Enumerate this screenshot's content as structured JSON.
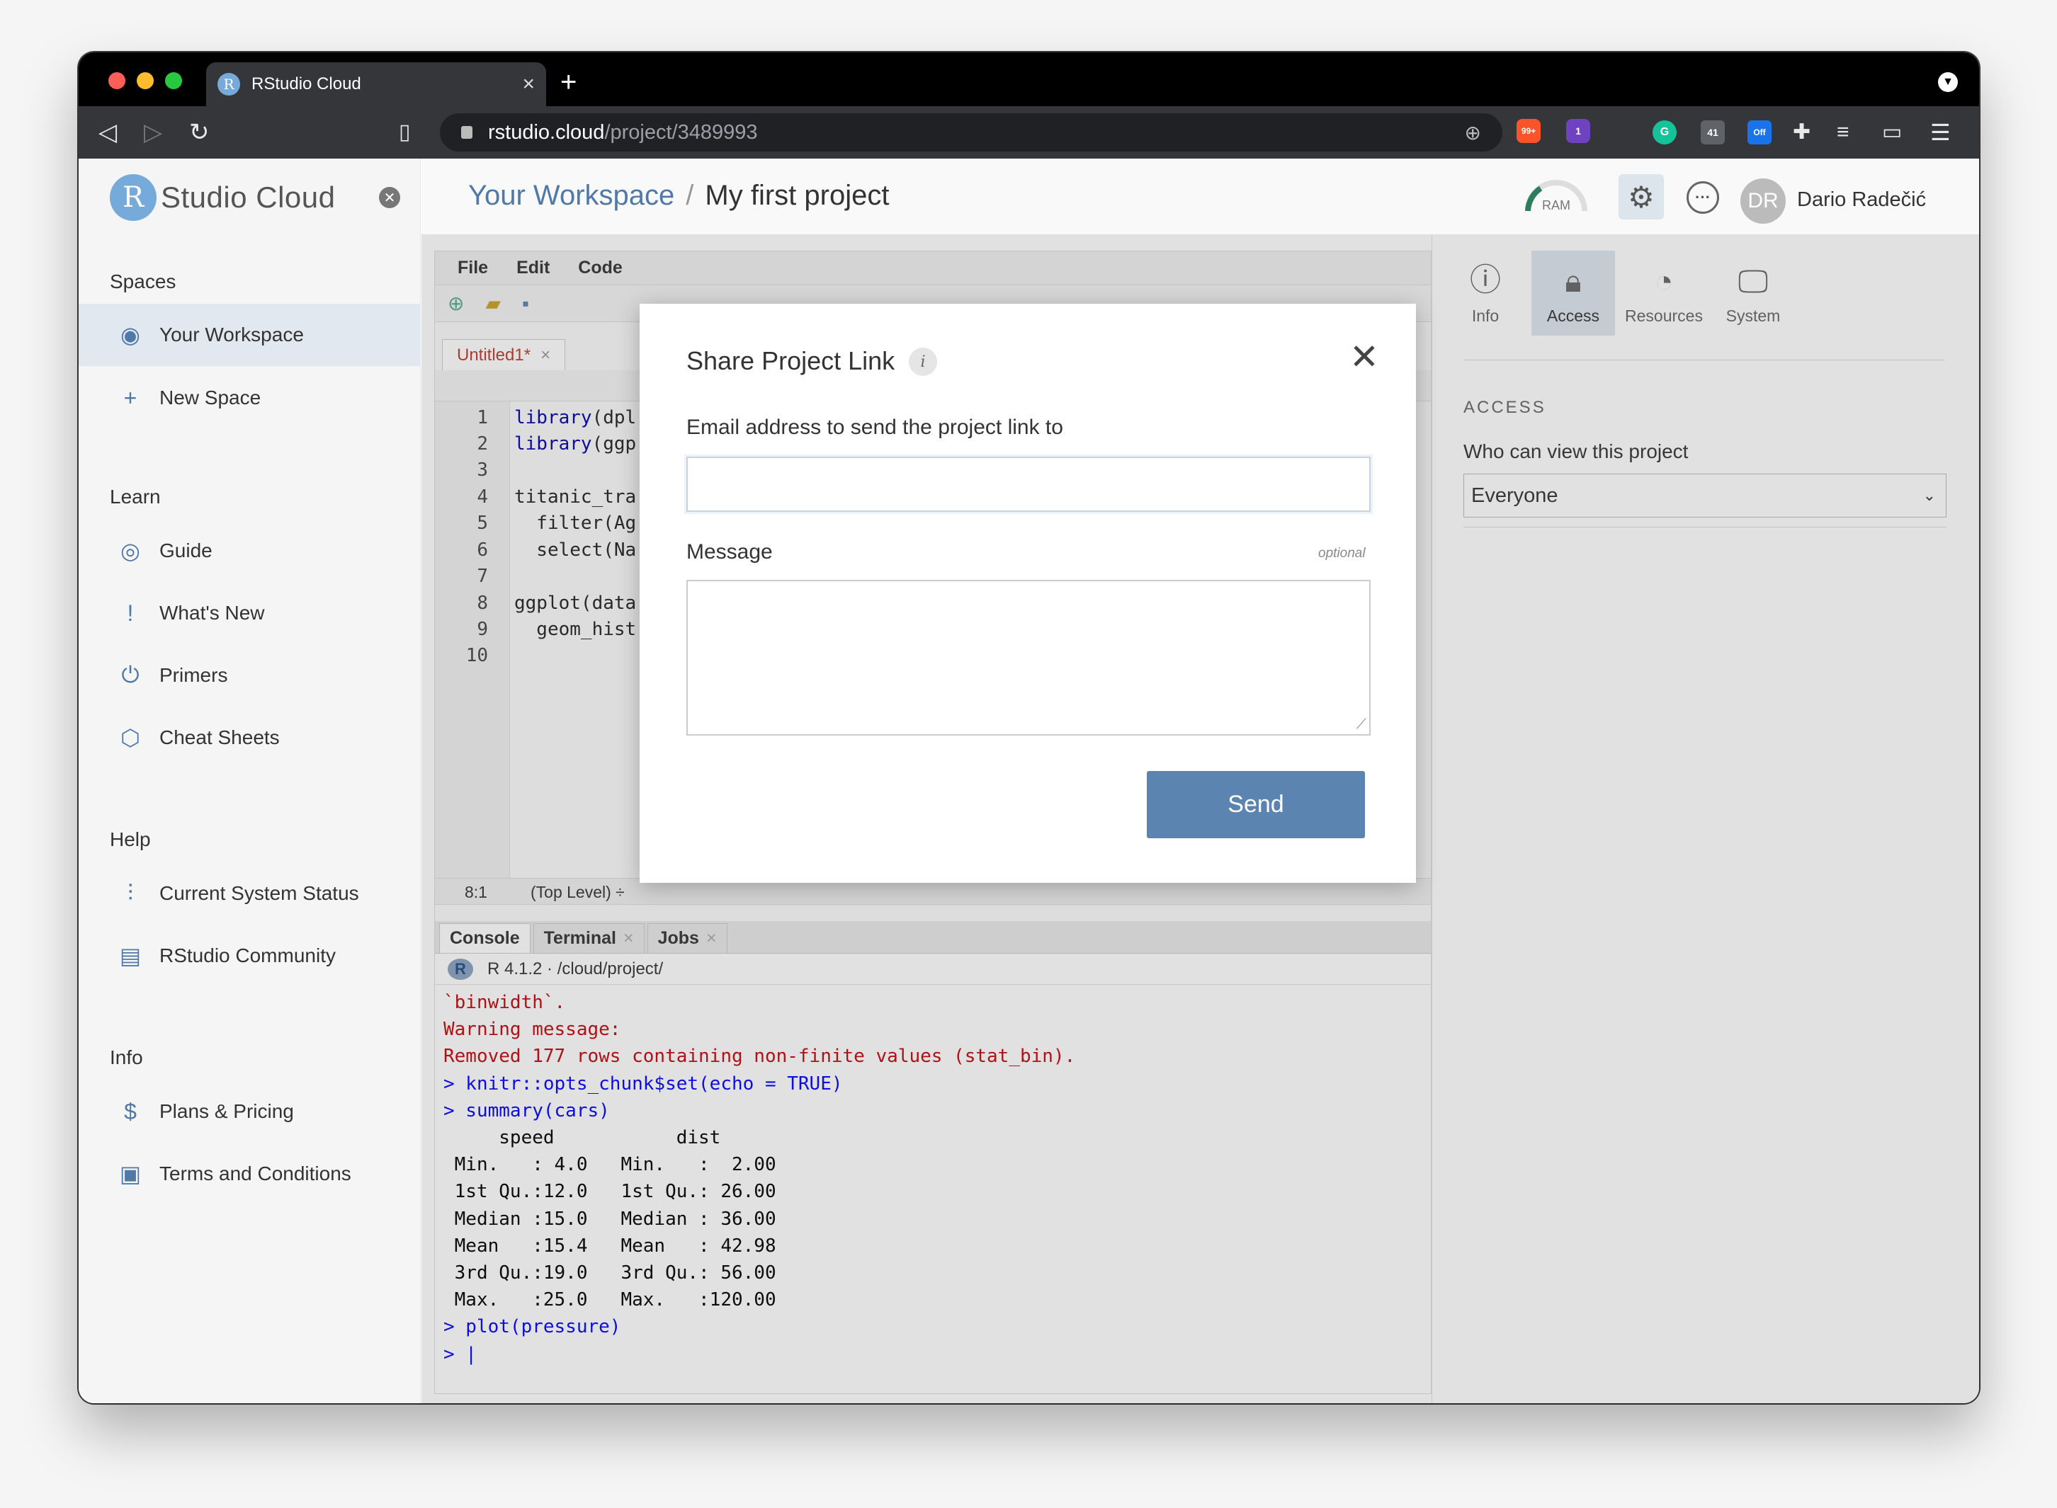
{
  "browser": {
    "tab_title": "RStudio Cloud",
    "tab_favicon": "R",
    "tab_close": "×",
    "new_tab": "+",
    "url_domain": "rstudio.cloud",
    "url_path": "/project/3489993",
    "brave_badge": "99+",
    "alert_badge": "1",
    "ext_calendar": "41",
    "ext_off": "Off",
    "colors": {
      "traffic_red": "#ff5f57",
      "traffic_yellow": "#febc2e",
      "traffic_green": "#28c840"
    }
  },
  "sidebar": {
    "logo_letter": "R",
    "logo_text": "Studio Cloud",
    "sections": {
      "spaces": "Spaces",
      "learn": "Learn",
      "help": "Help",
      "info": "Info"
    },
    "items": {
      "your_workspace": "Your Workspace",
      "new_space": "New Space",
      "guide": "Guide",
      "whats_new": "What's New",
      "primers": "Primers",
      "cheat_sheets": "Cheat Sheets",
      "system_status": "Current System Status",
      "community": "RStudio Community",
      "plans": "Plans & Pricing",
      "terms": "Terms and Conditions"
    }
  },
  "header": {
    "workspace": "Your Workspace",
    "separator": "/",
    "project": "My first project",
    "ram": "RAM",
    "avatar_initials": "DR",
    "user_name": "Dario Radečić"
  },
  "ide": {
    "menu": [
      "File",
      "Edit",
      "Code"
    ],
    "doc_tab": "Untitled1*",
    "doc_tab_close": "×",
    "line_numbers": [
      "1",
      "2",
      "3",
      "4",
      "5",
      "6",
      "7",
      "8",
      "9",
      "10"
    ],
    "code_lines": [
      {
        "fn": "library",
        "rest": "(dpl"
      },
      {
        "fn": "library",
        "rest": "(ggp"
      },
      {
        "fn": "",
        "rest": ""
      },
      {
        "fn": "",
        "rest": "titanic_tra"
      },
      {
        "fn": "  filter",
        "rest": "(Ag"
      },
      {
        "fn": "  select",
        "rest": "(Na"
      },
      {
        "fn": "",
        "rest": ""
      },
      {
        "fn": "ggplot",
        "rest": "(data"
      },
      {
        "fn": "",
        "rest": "  geom_hist"
      },
      {
        "fn": "",
        "rest": ""
      }
    ],
    "cursor_pos": "8:1",
    "scope": "(Top Level) ÷",
    "console_tabs": {
      "console": "Console",
      "terminal": "Terminal",
      "jobs": "Jobs",
      "close": "×"
    },
    "r_version": "R 4.1.2 · /cloud/project/",
    "console_lines": [
      {
        "t": "err",
        "text": "`binwidth`."
      },
      {
        "t": "err",
        "text": "Warning message:"
      },
      {
        "t": "err",
        "text": "Removed 177 rows containing non-finite values (stat_bin)."
      },
      {
        "t": "cmd",
        "text": "> knitr::opts_chunk$set(echo = TRUE)"
      },
      {
        "t": "cmd",
        "text": "> summary(cars)"
      },
      {
        "t": "out",
        "text": "     speed           dist       "
      },
      {
        "t": "out",
        "text": " Min.   : 4.0   Min.   :  2.00  "
      },
      {
        "t": "out",
        "text": " 1st Qu.:12.0   1st Qu.: 26.00  "
      },
      {
        "t": "out",
        "text": " Median :15.0   Median : 36.00  "
      },
      {
        "t": "out",
        "text": " Mean   :15.4   Mean   : 42.98  "
      },
      {
        "t": "out",
        "text": " 3rd Qu.:19.0   3rd Qu.: 56.00  "
      },
      {
        "t": "out",
        "text": " Max.   :25.0   Max.   :120.00  "
      },
      {
        "t": "cmd",
        "text": "> plot(pressure)"
      },
      {
        "t": "cmd",
        "text": "> |"
      }
    ]
  },
  "right_panel": {
    "tabs": {
      "info": "Info",
      "access": "Access",
      "resources": "Resources",
      "system": "System"
    },
    "access_heading": "ACCESS",
    "who_label": "Who can view this project",
    "who_value": "Everyone"
  },
  "modal": {
    "title": "Share Project Link",
    "info_icon": "i",
    "close": "✕",
    "email_label": "Email address to send the project link to",
    "email_value": "",
    "message_label": "Message",
    "optional": "optional",
    "message_value": "",
    "send": "Send"
  }
}
